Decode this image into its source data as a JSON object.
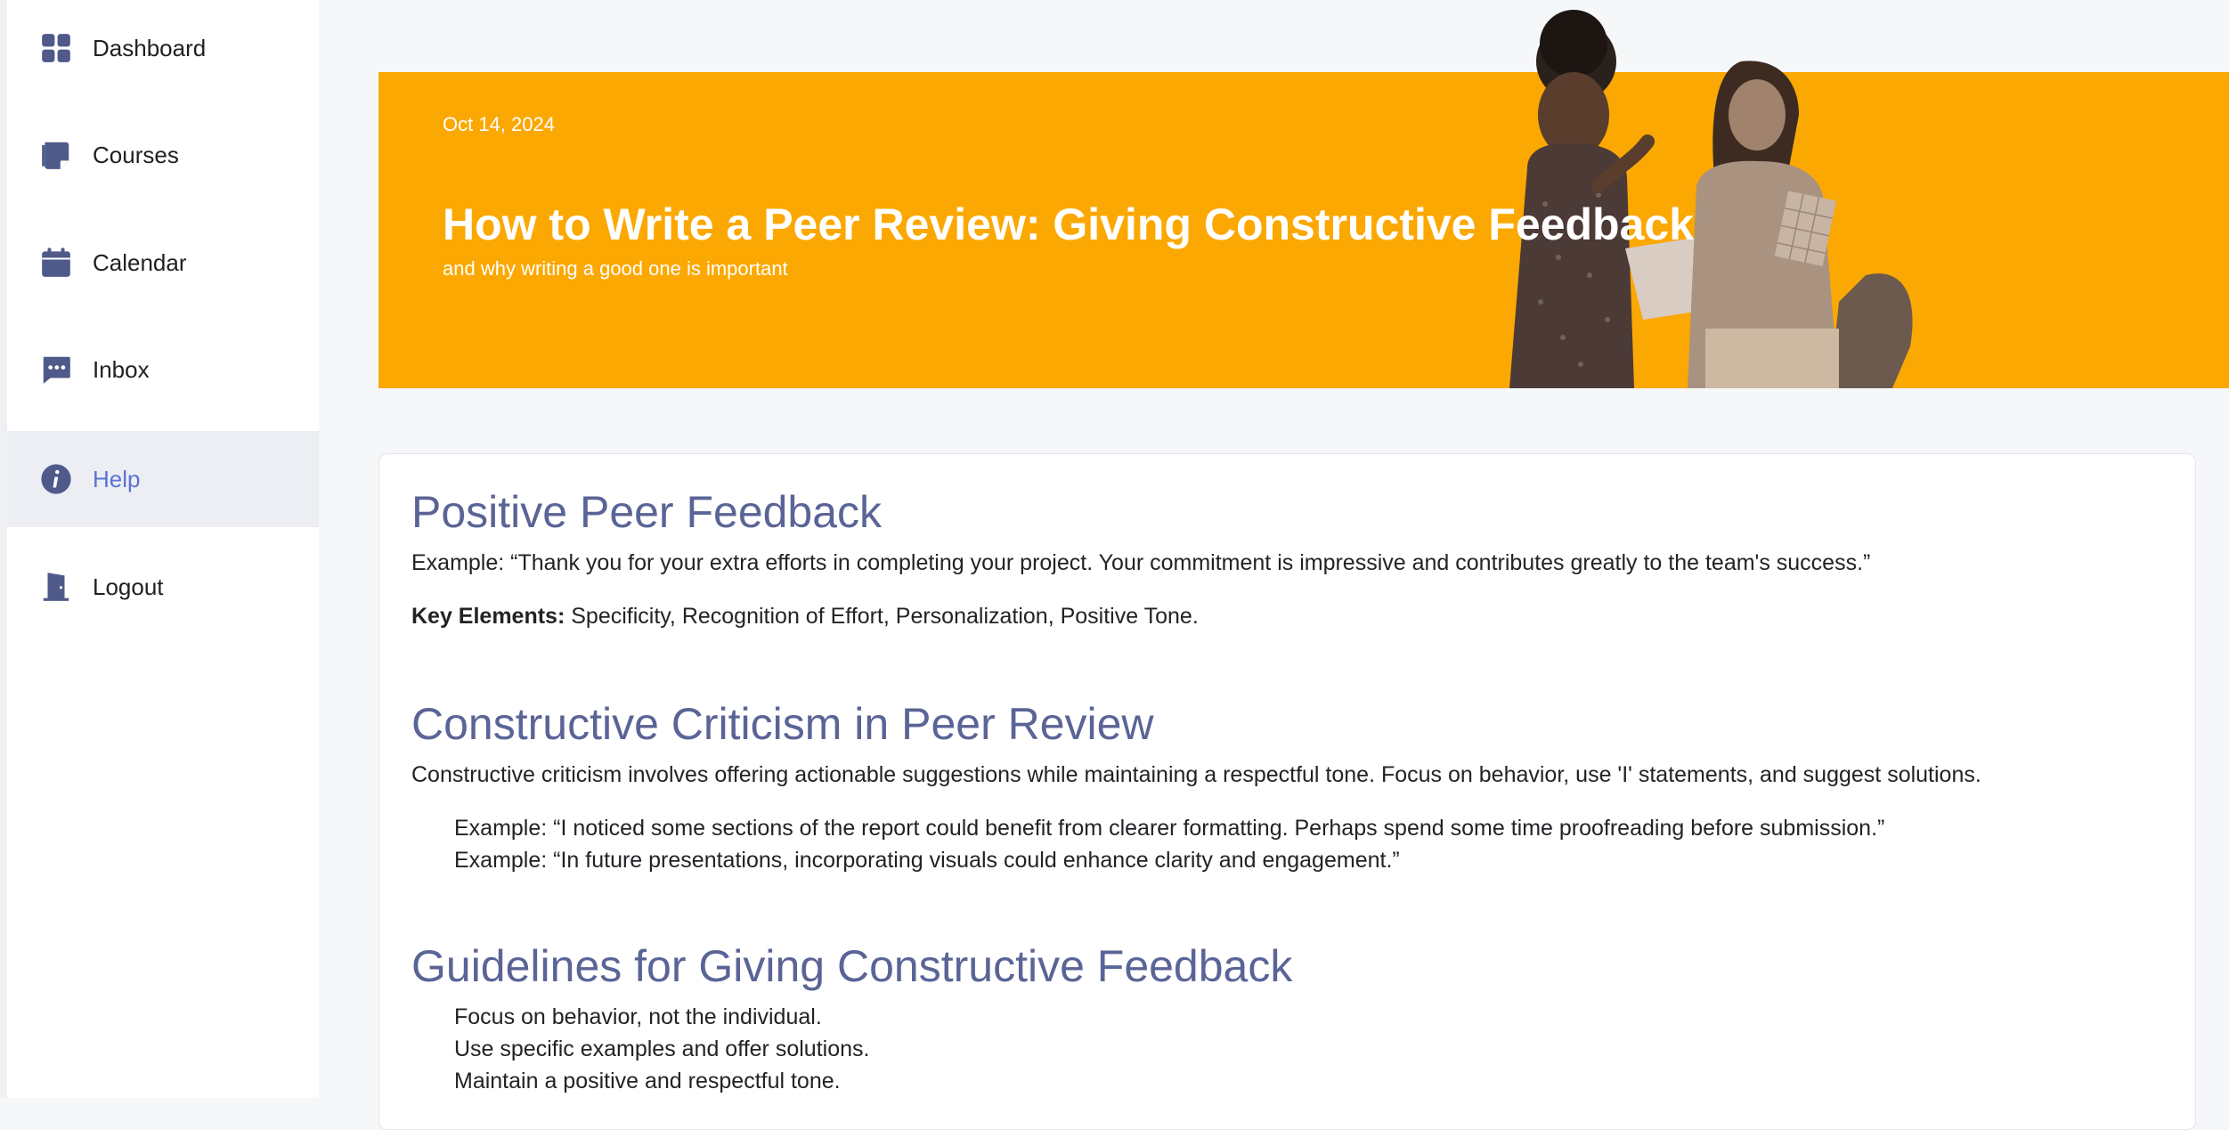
{
  "sidebar": {
    "items": [
      {
        "label": "Dashboard",
        "icon": "grid-icon"
      },
      {
        "label": "Courses",
        "icon": "courses-icon"
      },
      {
        "label": "Calendar",
        "icon": "calendar-icon"
      },
      {
        "label": "Inbox",
        "icon": "chat-icon"
      },
      {
        "label": "Help",
        "icon": "info-icon",
        "active": true
      },
      {
        "label": "Logout",
        "icon": "door-icon"
      }
    ]
  },
  "hero": {
    "date": "Oct 14, 2024",
    "title": "How to Write a Peer Review: Giving Constructive Feedback",
    "subtitle": "and why writing a good one is important"
  },
  "sections": {
    "positive": {
      "heading": "Positive Peer Feedback",
      "example": "Example: “Thank you for your extra efforts in completing your project. Your commitment is impressive and contributes greatly to the team's success.”",
      "key_label": "Key Elements:",
      "key_text": " Specificity, Recognition of Effort, Personalization, Positive Tone."
    },
    "constructive": {
      "heading": "Constructive Criticism in Peer Review",
      "intro": "Constructive criticism involves offering actionable suggestions while maintaining a respectful tone. Focus on behavior, use 'I' statements, and suggest solutions.",
      "examples": [
        "Example: “I noticed some sections of the report could benefit from clearer formatting. Perhaps spend some time proofreading before submission.”",
        "Example: “In future presentations, incorporating visuals could enhance clarity and engagement.”"
      ]
    },
    "guidelines": {
      "heading": "Guidelines for Giving Constructive Feedback",
      "items": [
        "Focus on behavior, not the individual.",
        "Use specific examples and offer solutions.",
        "Maintain a positive and respectful tone."
      ]
    }
  },
  "colors": {
    "accent": "#fba802",
    "heading": "#5a6496",
    "active_nav": "#5b73d0",
    "icon": "#4f5a8a"
  }
}
